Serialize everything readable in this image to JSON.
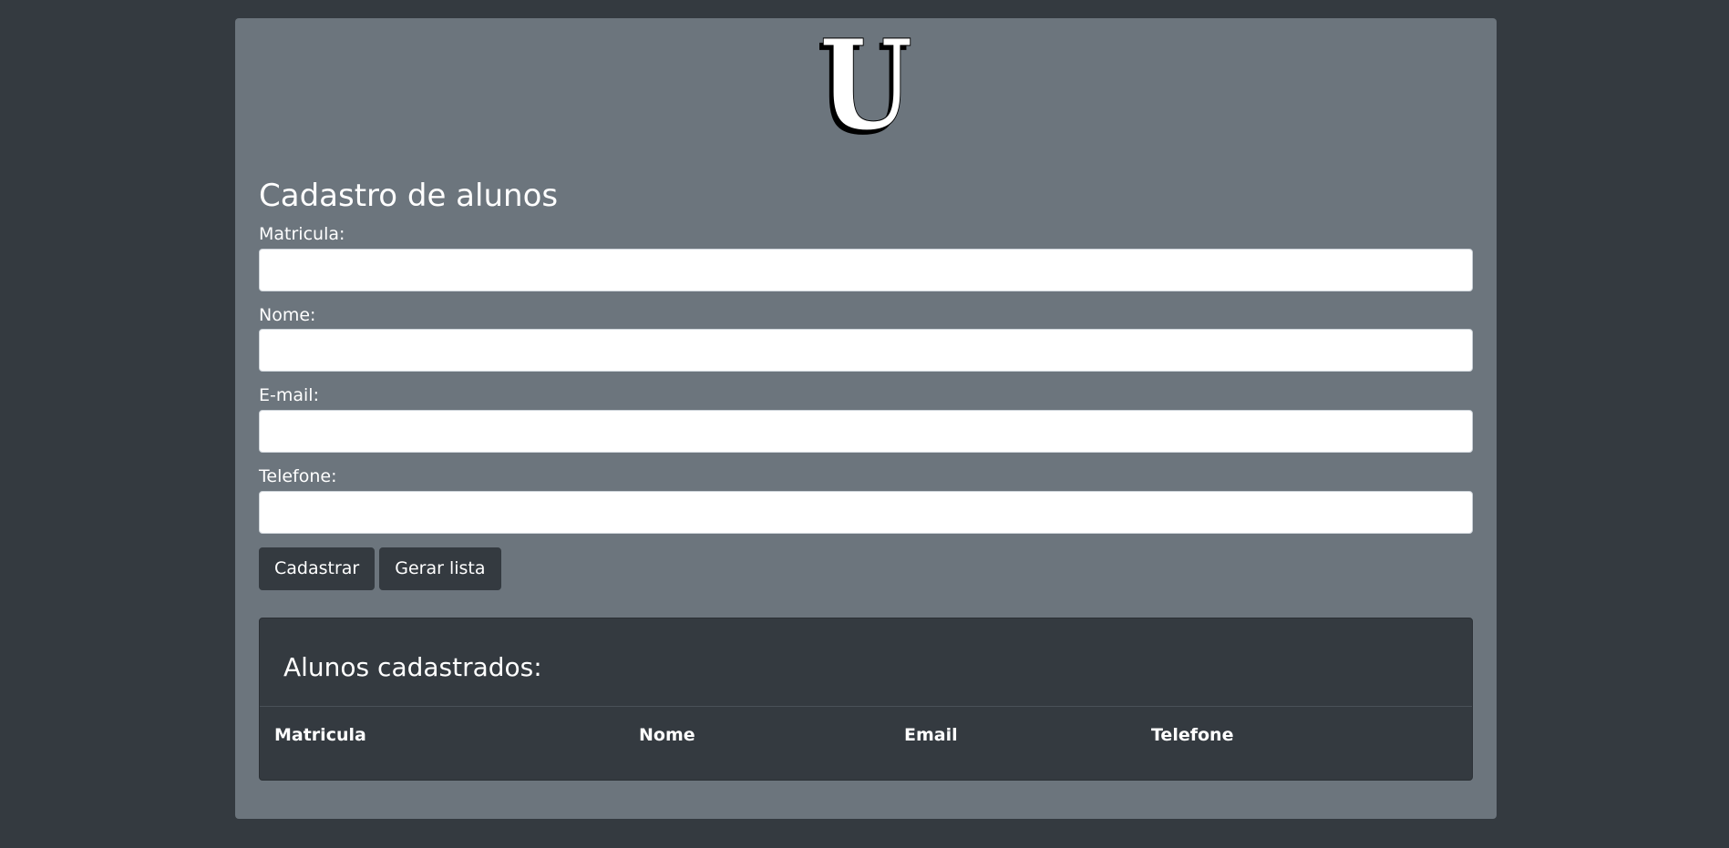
{
  "logo": {
    "letter": "U"
  },
  "form": {
    "title": "Cadastro de alunos",
    "fields": [
      {
        "label": "Matricula:",
        "value": "",
        "placeholder": ""
      },
      {
        "label": "Nome:",
        "value": "",
        "placeholder": ""
      },
      {
        "label": "E-mail:",
        "value": "",
        "placeholder": ""
      },
      {
        "label": "Telefone:",
        "value": "",
        "placeholder": ""
      }
    ],
    "submit_label": "Cadastrar",
    "list_label": "Gerar lista"
  },
  "students": {
    "title": "Alunos cadastrados:",
    "columns": [
      "Matricula",
      "Nome",
      "Email",
      "Telefone"
    ],
    "rows": []
  },
  "colors": {
    "background": "#343a40",
    "panel": "#6c757d",
    "button": "#343a40"
  }
}
